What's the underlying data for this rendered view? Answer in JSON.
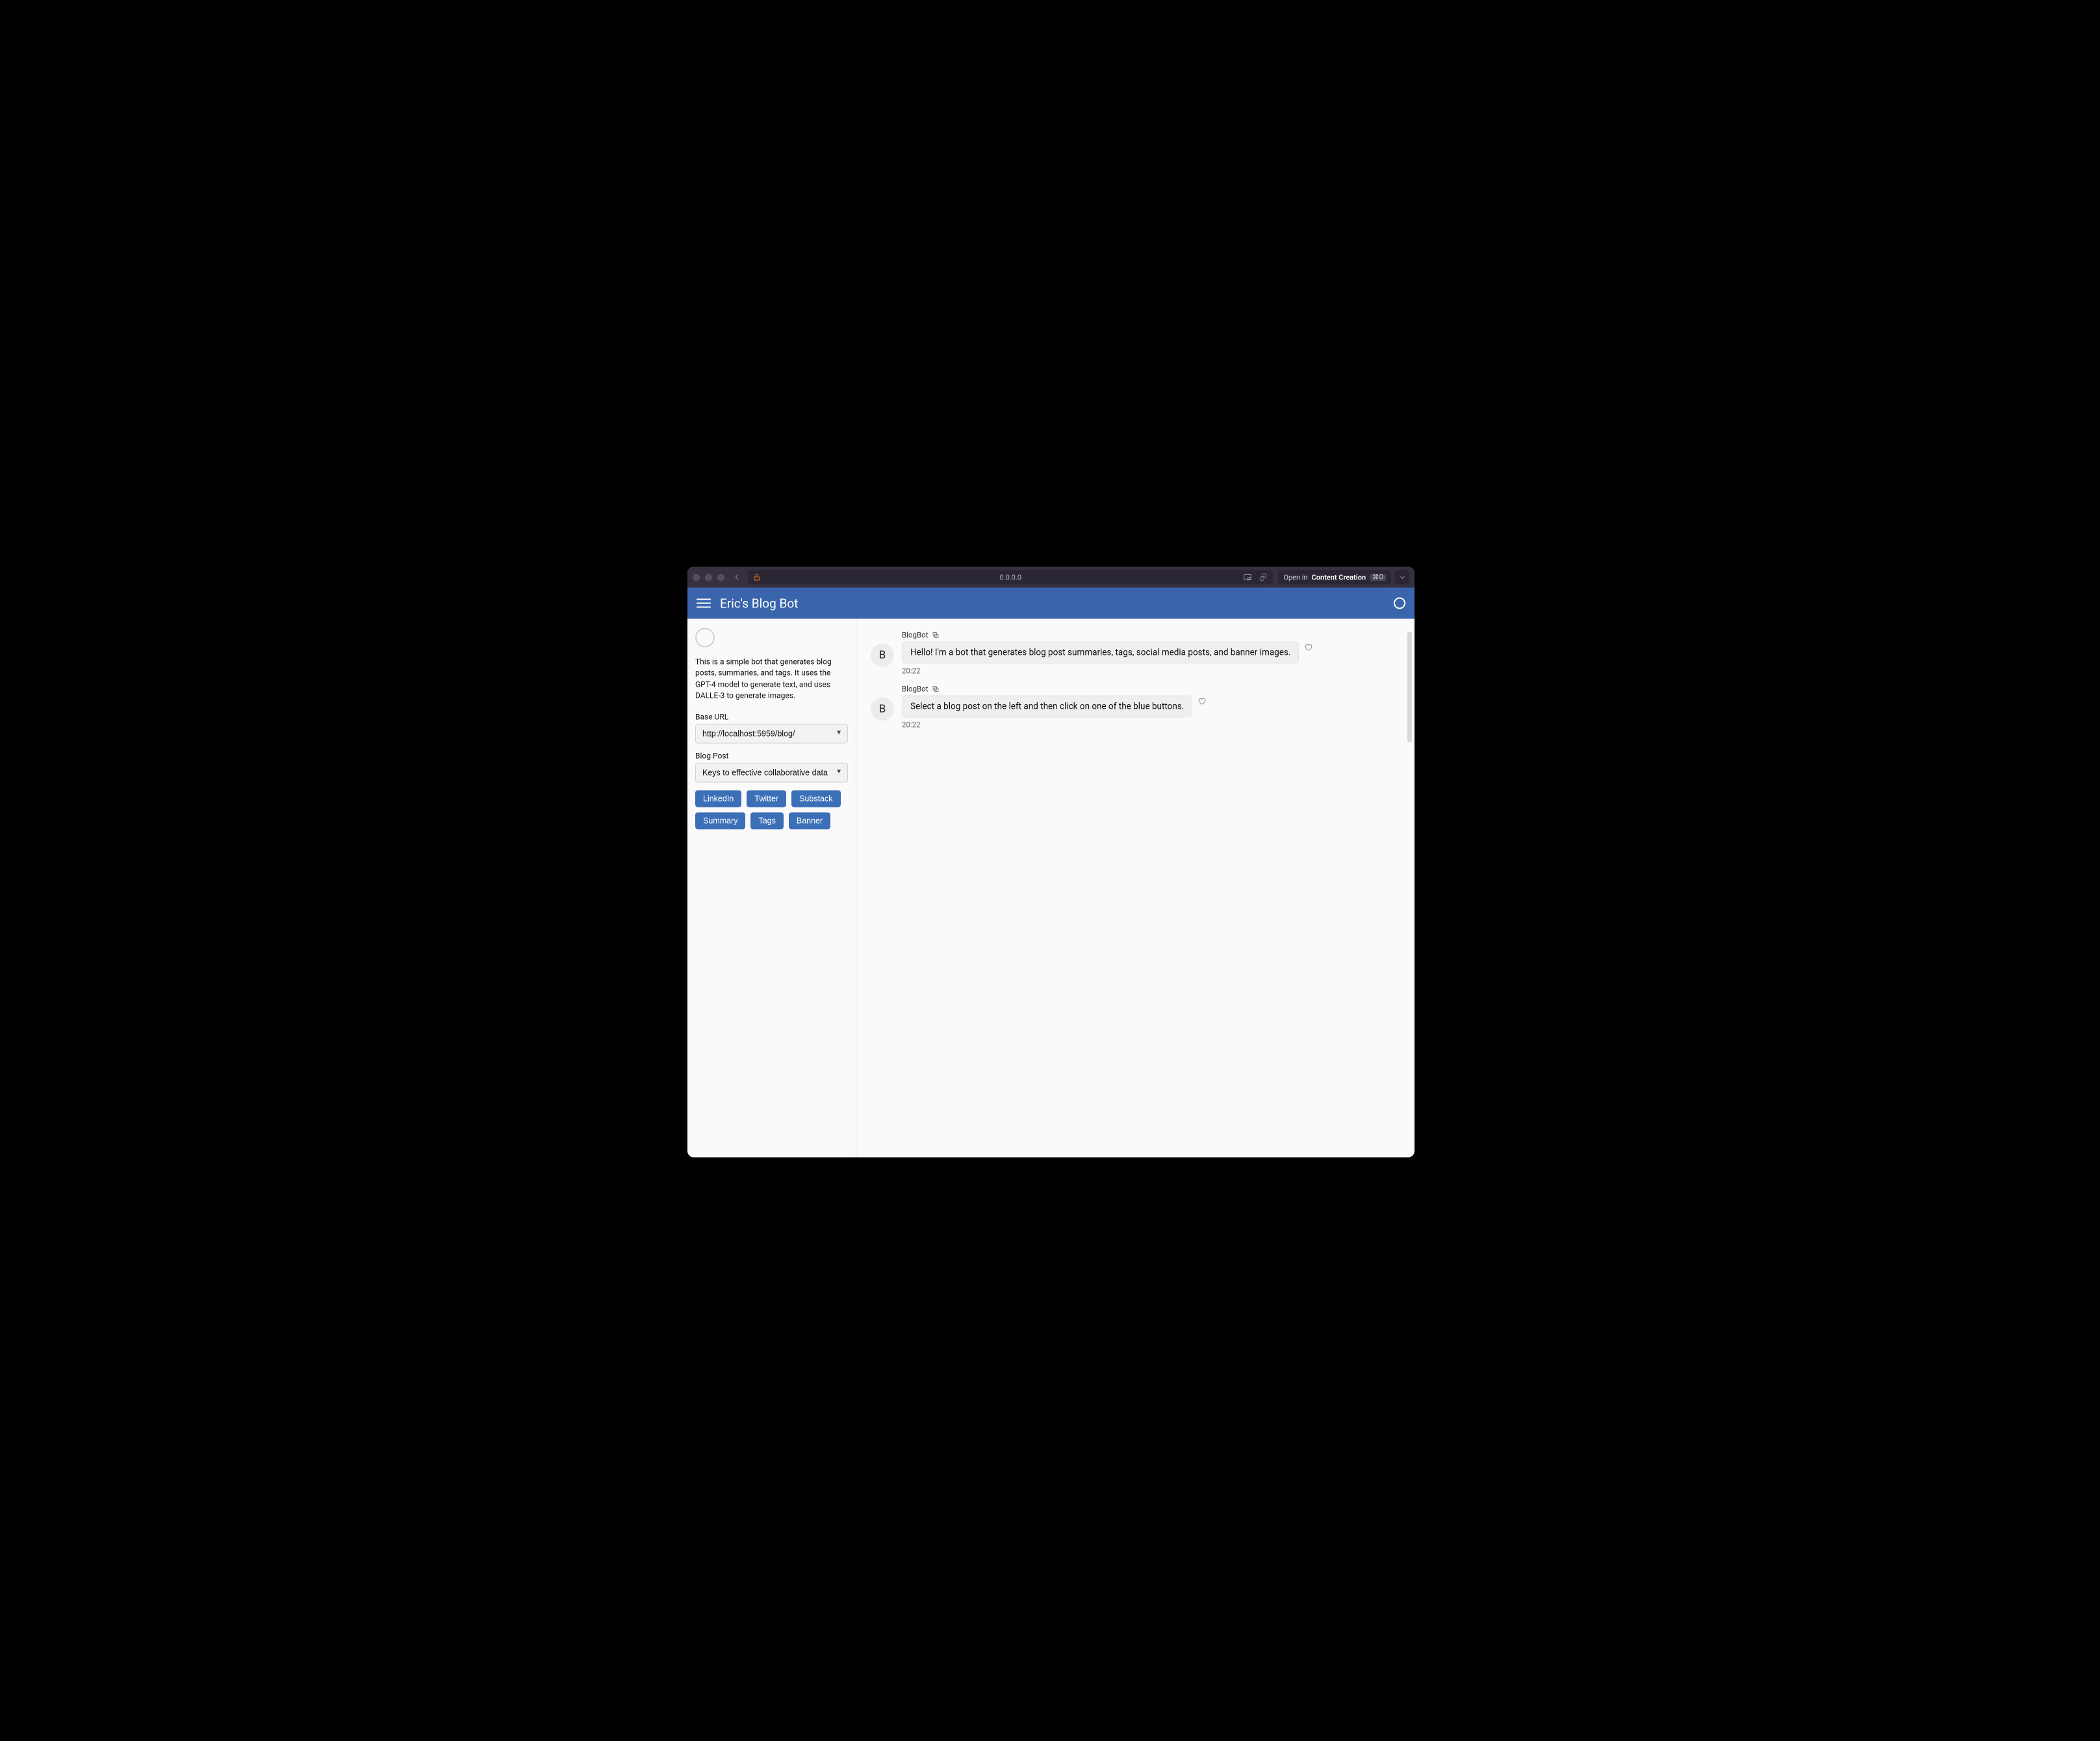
{
  "titlebar": {
    "address": "0.0.0.0",
    "openin_prefix": "Open in ",
    "openin_target": "Content Creation",
    "openin_shortcut": "⌘O"
  },
  "header": {
    "title": "Eric's Blog Bot"
  },
  "sidebar": {
    "description": "This is a simple bot that generates blog posts, summaries, and tags. It uses the GPT-4 model to generate text, and uses DALLE-3 to generate images.",
    "base_url_label": "Base URL",
    "base_url_value": "http://localhost:5959/blog/",
    "blog_post_label": "Blog Post",
    "blog_post_value": "Keys to effective collaborative data science",
    "buttons_row1": [
      "LinkedIn",
      "Twitter",
      "Substack"
    ],
    "buttons_row2": [
      "Summary",
      "Tags",
      "Banner"
    ]
  },
  "chat": {
    "messages": [
      {
        "author": "BlogBot",
        "avatar_letter": "B",
        "text": "Hello! I'm a bot that generates blog post summaries, tags, social media posts, and banner images.",
        "time": "20:22"
      },
      {
        "author": "BlogBot",
        "avatar_letter": "B",
        "text": "Select a blog post on the left and then click on one of the blue buttons.",
        "time": "20:22"
      }
    ]
  }
}
